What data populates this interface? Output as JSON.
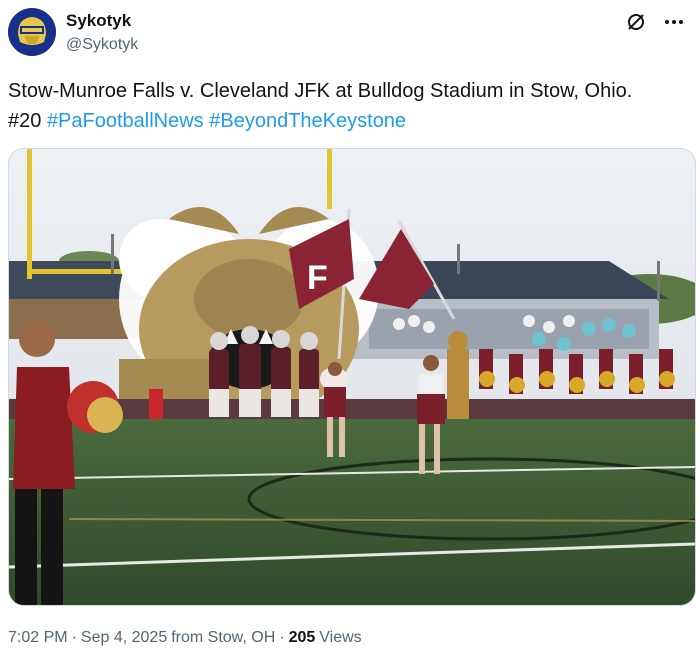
{
  "author": {
    "display_name": "Sykotyk",
    "handle": "@Sykotyk",
    "avatar_icon": "helmet-logo-avatar"
  },
  "header_icons": [
    "grok-icon",
    "more-icon"
  ],
  "tweet": {
    "text_main": "Stow-Munroe Falls v. Cleveland JFK at Bulldog Stadium in Stow, Ohio.",
    "text_number": "#20",
    "hashtag_1": "#PaFootballNews",
    "hashtag_2": "#BeyondTheKeystone"
  },
  "media": {
    "description_icon": "football-team-entrance-photo"
  },
  "meta": {
    "time": "7:02 PM",
    "separator": "·",
    "date": "Sep 4, 2025",
    "location": "from Stow, OH",
    "separator_2": "·",
    "views_count": "205",
    "views_label": "Views"
  },
  "colors": {
    "link": "#1d9bf0",
    "secondary_text": "#536471",
    "maroon": "#7a1f2b"
  }
}
